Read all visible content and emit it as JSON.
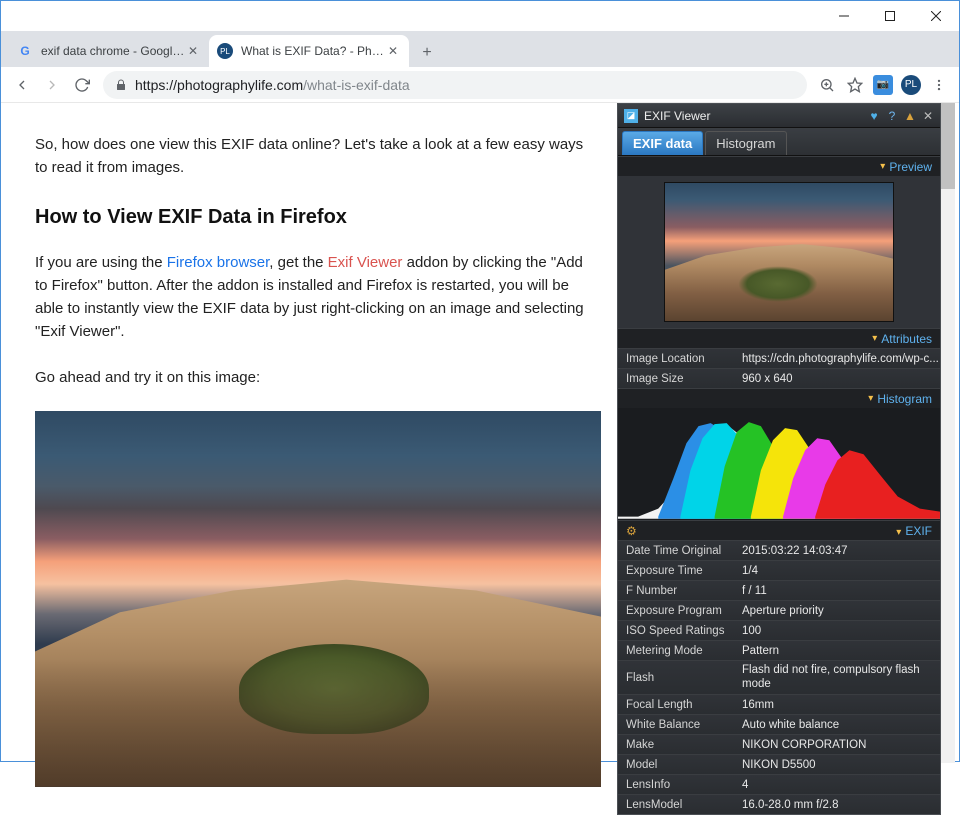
{
  "tabs": [
    {
      "label": "exif data chrome - Google Search",
      "favicon": "google"
    },
    {
      "label": "What is EXIF Data? - Photograph",
      "favicon": "pl"
    }
  ],
  "url": {
    "scheme": "https://",
    "host": "photographylife.com",
    "path": "/what-is-exif-data"
  },
  "page": {
    "para1": "So, how does one view this EXIF data online? Let's take a look at a few easy ways to read it from images.",
    "heading": "How to View EXIF Data in Firefox",
    "para2a": "If you are using the ",
    "link_firefox": "Firefox browser",
    "para2b": ", get the ",
    "link_exifviewer": "Exif Viewer",
    "para2c": " addon by clicking the \"Add to Firefox\" button. After the addon is installed and Firefox is restarted, you will be able to instantly view the EXIF data by just right-clicking on an image and selecting \"Exif Viewer\".",
    "para3": "Go ahead and try it on this image:"
  },
  "panel": {
    "title": "EXIF Viewer",
    "tabs": {
      "exif": "EXIF data",
      "hist": "Histogram"
    },
    "sections": {
      "preview": "Preview",
      "attributes": "Attributes",
      "histogram": "Histogram",
      "exif": "EXIF"
    },
    "attributes": [
      {
        "k": "Image Location",
        "v": "https://cdn.photographylife.com/wp-c..."
      },
      {
        "k": "Image Size",
        "v": "960 x 640"
      }
    ],
    "exif": [
      {
        "k": "Date Time Original",
        "v": "2015:03:22 14:03:47"
      },
      {
        "k": "Exposure Time",
        "v": "1/4"
      },
      {
        "k": "F Number",
        "v": "f / 11"
      },
      {
        "k": "Exposure Program",
        "v": "Aperture priority"
      },
      {
        "k": "ISO Speed Ratings",
        "v": "100"
      },
      {
        "k": "Metering Mode",
        "v": "Pattern"
      },
      {
        "k": "Flash",
        "v": "Flash did not fire, compulsory flash mode",
        "tall": true
      },
      {
        "k": "Focal Length",
        "v": "16mm"
      },
      {
        "k": "White Balance",
        "v": "Auto white balance"
      },
      {
        "k": "Make",
        "v": "NIKON CORPORATION"
      },
      {
        "k": "Model",
        "v": "NIKON D5500"
      },
      {
        "k": "LensInfo",
        "v": "4"
      },
      {
        "k": "LensModel",
        "v": "16.0-28.0 mm f/2.8"
      }
    ]
  }
}
